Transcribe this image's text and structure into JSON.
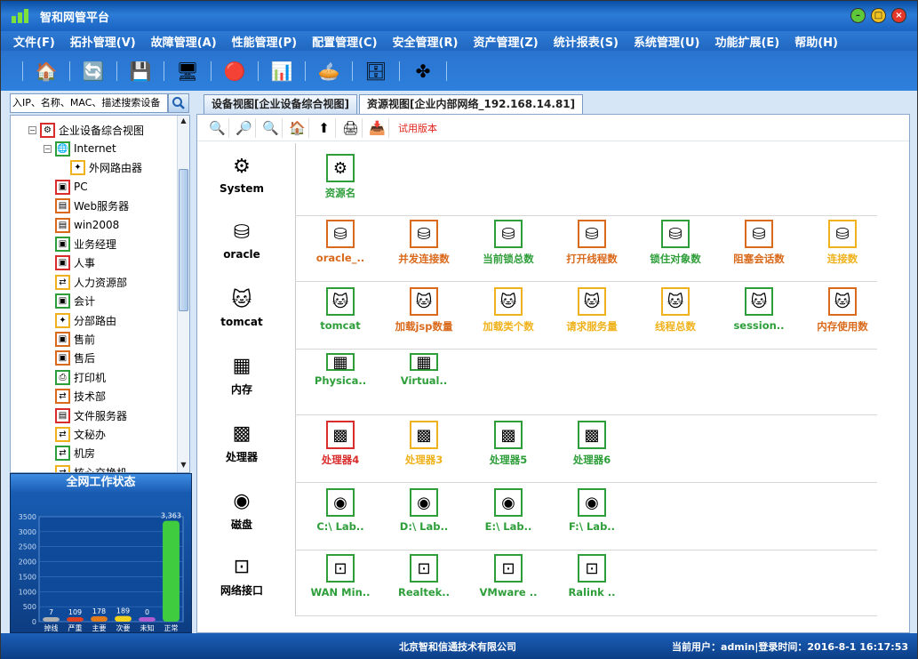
{
  "window": {
    "title": "智和网管平台"
  },
  "menu": [
    "文件(F)",
    "拓扑管理(V)",
    "故障管理(A)",
    "性能管理(P)",
    "配置管理(C)",
    "安全管理(R)",
    "资产管理(Z)",
    "统计报表(S)",
    "系统管理(U)",
    "功能扩展(E)",
    "帮助(H)"
  ],
  "search": {
    "value": "入IP、名称、MAC、描述搜索设备"
  },
  "tree": [
    {
      "label": "企业设备综合视图",
      "level": 0,
      "exp": "⊟",
      "color": "#d92d2d",
      "icon": "topology-icon"
    },
    {
      "label": "Internet",
      "level": 1,
      "exp": "⊟",
      "color": "#2e9e3a",
      "icon": "globe-icon"
    },
    {
      "label": "外网路由器",
      "level": 2,
      "exp": "",
      "color": "#f0b21c",
      "icon": "router-icon"
    },
    {
      "label": "PC",
      "level": 1,
      "exp": "",
      "color": "#d92d2d",
      "icon": "pc-icon"
    },
    {
      "label": "Web服务器",
      "level": 1,
      "exp": "",
      "color": "#d96a1c",
      "icon": "server-icon"
    },
    {
      "label": "win2008",
      "level": 1,
      "exp": "",
      "color": "#d96a1c",
      "icon": "server-icon"
    },
    {
      "label": "业务经理",
      "level": 1,
      "exp": "",
      "color": "#2e9e3a",
      "icon": "pc-icon"
    },
    {
      "label": "人事",
      "level": 1,
      "exp": "",
      "color": "#d92d2d",
      "icon": "pc-icon"
    },
    {
      "label": "人力资源部",
      "level": 1,
      "exp": "",
      "color": "#f0b21c",
      "icon": "switch-icon"
    },
    {
      "label": "会计",
      "level": 1,
      "exp": "",
      "color": "#2e9e3a",
      "icon": "pc-icon"
    },
    {
      "label": "分部路由",
      "level": 1,
      "exp": "",
      "color": "#f0b21c",
      "icon": "router-icon"
    },
    {
      "label": "售前",
      "level": 1,
      "exp": "",
      "color": "#d96a1c",
      "icon": "pc-icon"
    },
    {
      "label": "售后",
      "level": 1,
      "exp": "",
      "color": "#d96a1c",
      "icon": "pc-icon"
    },
    {
      "label": "打印机",
      "level": 1,
      "exp": "",
      "color": "#2e9e3a",
      "icon": "printer-icon"
    },
    {
      "label": "技术部",
      "level": 1,
      "exp": "",
      "color": "#d96a1c",
      "icon": "switch-icon"
    },
    {
      "label": "文件服务器",
      "level": 1,
      "exp": "",
      "color": "#d92d2d",
      "icon": "server-icon"
    },
    {
      "label": "文秘办",
      "level": 1,
      "exp": "",
      "color": "#f0b21c",
      "icon": "switch-icon"
    },
    {
      "label": "机房",
      "level": 1,
      "exp": "",
      "color": "#2e9e3a",
      "icon": "switch-icon"
    },
    {
      "label": "核心交换机",
      "level": 1,
      "exp": "",
      "color": "#f0b21c",
      "icon": "switch-icon"
    }
  ],
  "status_panel": {
    "title": "全网工作状态"
  },
  "tabs": [
    "设备视图[企业设备综合视图]",
    "资源视图[企业内部网络_192.168.14.81]"
  ],
  "view_toolbar": {
    "trial_label": "试用版本"
  },
  "resource_rows": [
    {
      "category": "System",
      "cat_icon": "gear-icon",
      "items": [
        {
          "label": "资源名",
          "color": "#2e9e3a",
          "icon": "gear-icon"
        }
      ]
    },
    {
      "category": "oracle",
      "cat_icon": "database-icon",
      "items": [
        {
          "label": "oracle_..",
          "color": "#d96a1c",
          "icon": "database-icon"
        },
        {
          "label": "并发连接数",
          "color": "#d96a1c",
          "icon": "database-icon"
        },
        {
          "label": "当前锁总数",
          "color": "#2e9e3a",
          "icon": "database-icon"
        },
        {
          "label": "打开线程数",
          "color": "#d96a1c",
          "icon": "database-icon"
        },
        {
          "label": "锁住对象数",
          "color": "#2e9e3a",
          "icon": "database-icon"
        },
        {
          "label": "阻塞会话数",
          "color": "#d96a1c",
          "icon": "database-icon"
        },
        {
          "label": "连接数",
          "color": "#f0b21c",
          "icon": "database-icon"
        }
      ]
    },
    {
      "category": "tomcat",
      "cat_icon": "tomcat-icon",
      "items": [
        {
          "label": "tomcat",
          "color": "#2e9e3a",
          "icon": "tomcat-icon"
        },
        {
          "label": "加载jsp数量",
          "color": "#d96a1c",
          "icon": "tomcat-icon"
        },
        {
          "label": "加载类个数",
          "color": "#f0b21c",
          "icon": "tomcat-icon"
        },
        {
          "label": "请求服务量",
          "color": "#f0b21c",
          "icon": "tomcat-icon"
        },
        {
          "label": "线程总数",
          "color": "#f0b21c",
          "icon": "tomcat-icon"
        },
        {
          "label": "session..",
          "color": "#2e9e3a",
          "icon": "tomcat-icon"
        },
        {
          "label": "内存使用数",
          "color": "#d96a1c",
          "icon": "tomcat-icon"
        }
      ]
    },
    {
      "category": "内存",
      "cat_icon": "memory-icon",
      "items": [
        {
          "label": "Physica..",
          "color": "#2e9e3a",
          "icon": "memory-icon"
        },
        {
          "label": "Virtual..",
          "color": "#2e9e3a",
          "icon": "memory-icon"
        }
      ]
    },
    {
      "category": "处理器",
      "cat_icon": "cpu-icon",
      "items": [
        {
          "label": "处理器4",
          "color": "#d92d2d",
          "icon": "cpu-icon"
        },
        {
          "label": "处理器3",
          "color": "#f0b21c",
          "icon": "cpu-icon"
        },
        {
          "label": "处理器5",
          "color": "#2e9e3a",
          "icon": "cpu-icon"
        },
        {
          "label": "处理器6",
          "color": "#2e9e3a",
          "icon": "cpu-icon"
        }
      ]
    },
    {
      "category": "磁盘",
      "cat_icon": "disk-icon",
      "items": [
        {
          "label": "C:\\ Lab..",
          "color": "#2e9e3a",
          "icon": "disk-icon"
        },
        {
          "label": "D:\\ Lab..",
          "color": "#2e9e3a",
          "icon": "disk-icon"
        },
        {
          "label": "E:\\ Lab..",
          "color": "#2e9e3a",
          "icon": "disk-icon"
        },
        {
          "label": "F:\\ Lab..",
          "color": "#2e9e3a",
          "icon": "disk-icon"
        }
      ]
    },
    {
      "category": "网络接口",
      "cat_icon": "network-port-icon",
      "items": [
        {
          "label": "WAN Min..",
          "color": "#2e9e3a",
          "icon": "network-port-icon"
        },
        {
          "label": "Realtek..",
          "color": "#2e9e3a",
          "icon": "network-port-icon"
        },
        {
          "label": "VMware ..",
          "color": "#2e9e3a",
          "icon": "network-port-icon"
        },
        {
          "label": "Ralink ..",
          "color": "#2e9e3a",
          "icon": "network-port-icon"
        }
      ]
    }
  ],
  "footer": {
    "company": "北京智和信通技术有限公司",
    "user_info": "当前用户：admin|登录时间：2016-8-1 16:17:53"
  },
  "chart_data": {
    "type": "bar",
    "categories": [
      "掉线",
      "严重",
      "主要",
      "次要",
      "未知",
      "正常"
    ],
    "values": [
      7,
      109,
      178,
      189,
      0,
      3363
    ],
    "value_labels": [
      "7",
      "109",
      "178",
      "189",
      "0",
      "3,363"
    ],
    "colors": [
      "#b0b0b0",
      "#e0401e",
      "#e37b1a",
      "#f2d21c",
      "#b05bd0",
      "#3fcc3f"
    ],
    "yticks": [
      0,
      500,
      1000,
      1500,
      2000,
      2500,
      3000,
      3500
    ],
    "ylim": [
      0,
      3500
    ]
  }
}
